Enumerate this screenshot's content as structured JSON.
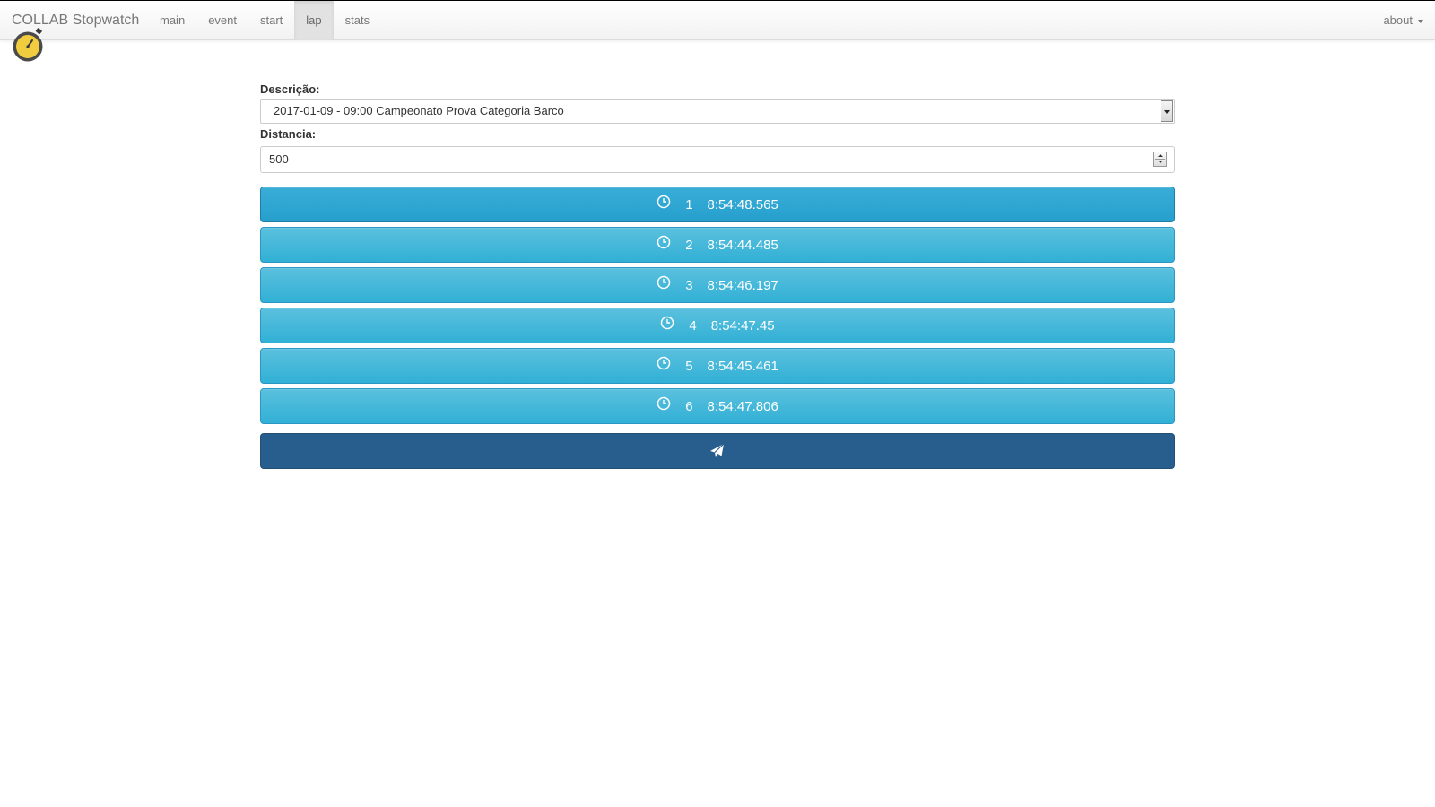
{
  "app": {
    "brand": "COLLAB Stopwatch",
    "logo_icon": "stopwatch-icon",
    "accent_color": "#5bc0de",
    "primary_color": "#285e8e"
  },
  "nav": {
    "items": [
      {
        "label": "main",
        "active": false
      },
      {
        "label": "event",
        "active": false
      },
      {
        "label": "start",
        "active": false
      },
      {
        "label": "lap",
        "active": true
      },
      {
        "label": "stats",
        "active": false
      }
    ],
    "about_label": "about"
  },
  "form": {
    "description_label": "Descrição:",
    "description_value": "2017-01-09 - 09:00 Campeonato Prova Categoria Barco",
    "distance_label": "Distancia:",
    "distance_value": "500"
  },
  "laps": [
    {
      "number": "1",
      "time": "8:54:48.565"
    },
    {
      "number": "2",
      "time": "8:54:44.485"
    },
    {
      "number": "3",
      "time": "8:54:46.197"
    },
    {
      "number": "4",
      "time": "8:54:47.45"
    },
    {
      "number": "5",
      "time": "8:54:45.461"
    },
    {
      "number": "6",
      "time": "8:54:47.806"
    }
  ],
  "send_button": {
    "icon": "send-icon"
  }
}
